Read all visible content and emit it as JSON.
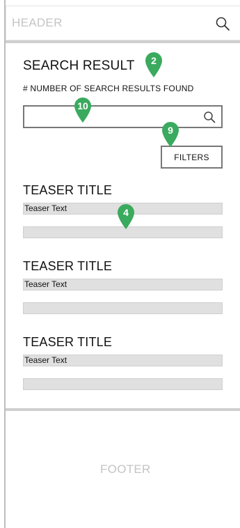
{
  "header": {
    "title": "HEADER",
    "search_icon": "search-icon"
  },
  "search": {
    "title": "SEARCH RESULT",
    "count_text": "# NUMBER OF SEARCH RESULTS FOUND",
    "input_value": "",
    "input_placeholder": "",
    "search_icon": "search-icon",
    "filters_label": "FILTERS"
  },
  "teasers": [
    {
      "title": "TEASER TITLE",
      "text": "Teaser Text"
    },
    {
      "title": "TEASER TITLE",
      "text": "Teaser Text"
    },
    {
      "title": "TEASER TITLE",
      "text": "Teaser Text"
    }
  ],
  "footer": {
    "title": "FOOTER"
  },
  "markers": [
    {
      "label": "2"
    },
    {
      "label": "10"
    },
    {
      "label": "9"
    },
    {
      "label": "4"
    }
  ],
  "colors": {
    "marker": "#3aaa5e",
    "separator": "#cfcfcf",
    "placeholder_text": "#c4c4c4"
  }
}
